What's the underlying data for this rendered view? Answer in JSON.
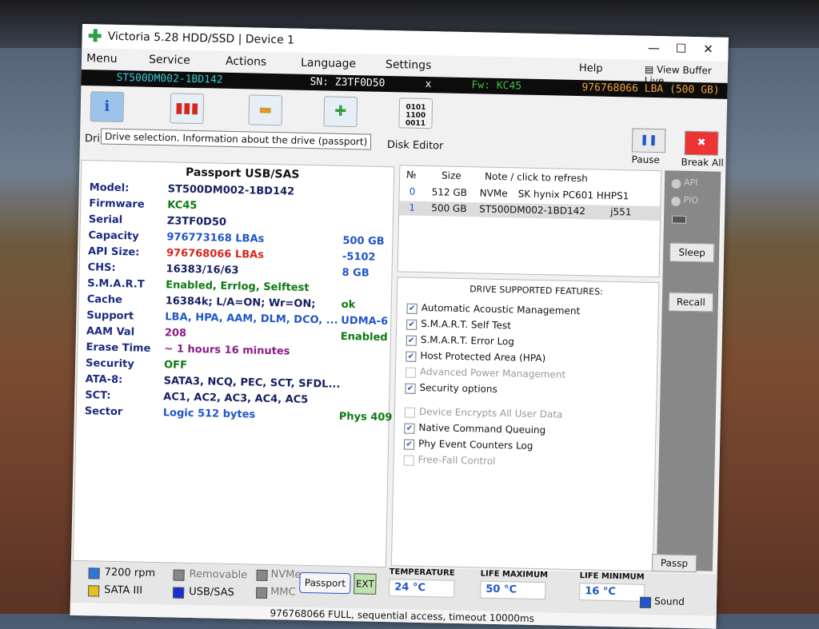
{
  "window": {
    "title": "Victoria 5.28 HDD/SSD | Device 1"
  },
  "window_controls": {
    "minimize": "—",
    "maximize": "☐",
    "close": "✕"
  },
  "menu": {
    "menu_label": "Menu",
    "service_label": "Service",
    "actions_label": "Actions",
    "language_label": "Language",
    "settings_label": "Settings",
    "help_label": "Help",
    "view_buffer_label": "View Buffer Live"
  },
  "drive_bar": {
    "model": "ST500DM002-1BD142",
    "serial": "SN: Z3TF0D50",
    "close_mark": "x",
    "firmware": "Fw: KC45",
    "lba": "976768066 LBA (500 GB)"
  },
  "toolbar": {
    "drive_label": "Driv",
    "disk_editor_label": "Disk Editor",
    "pause_label": "Pause",
    "break_all_label": "Break All",
    "tooltip": "Drive selection. Information about the drive (passport)",
    "tooltip_tail": "r"
  },
  "passport": {
    "title": "Passport USB/SAS",
    "rows": [
      {
        "key": "Model:",
        "value": "ST500DM002-1BD142",
        "extra": ""
      },
      {
        "key": "Firmware",
        "value": "KC45",
        "extra": ""
      },
      {
        "key": "Serial",
        "value": "Z3TF0D50",
        "extra": ""
      },
      {
        "key": "Capacity",
        "value": "976773168 LBAs",
        "extra": "500 GB"
      },
      {
        "key": "API Size:",
        "value": "976768066 LBAs",
        "extra": "-5102"
      },
      {
        "key": "CHS:",
        "value": "16383/16/63",
        "extra": "8 GB"
      },
      {
        "key": "S.M.A.R.T",
        "value": "Enabled, Errlog, Selftest",
        "extra": ""
      },
      {
        "key": "Cache",
        "value": "16384k; L/A=ON; Wr=ON;",
        "extra": "ok"
      },
      {
        "key": "Support",
        "value": "LBA, HPA, AAM, DLM, DCO, ...",
        "extra": "UDMA-6"
      },
      {
        "key": "AAM Val",
        "value": "208",
        "extra": "Enabled"
      },
      {
        "key": "Erase Time",
        "value": "~ 1 hours 16 minutes",
        "extra": ""
      },
      {
        "key": "Security",
        "value": "OFF",
        "extra": ""
      },
      {
        "key": "ATA-8:",
        "value": "SATA3, NCQ, PEC, SCT, SFDL...",
        "extra": ""
      },
      {
        "key": "SCT:",
        "value": "AC1, AC2, AC3, AC4, AC5",
        "extra": ""
      },
      {
        "key": "Sector",
        "value": "Logic 512 bytes",
        "extra": "Phys 409"
      }
    ]
  },
  "drive_list": {
    "columns": {
      "no": "№",
      "size": "Size",
      "note": "Note / click to refresh"
    },
    "rows": [
      {
        "no": "0",
        "size": "512 GB",
        "iface": "NVMe",
        "note": "SK hynix PC601 HHPS1",
        "tail": ""
      },
      {
        "no": "1",
        "size": "500 GB",
        "iface": "ST500DM002-1BD142",
        "note": "",
        "tail": "j551"
      }
    ]
  },
  "features": {
    "title": "DRIVE SUPPORTED FEATURES:",
    "items": [
      {
        "label": "Automatic Acoustic Management",
        "checked": "✔"
      },
      {
        "label": "S.M.A.R.T. Self Test",
        "checked": "✔"
      },
      {
        "label": "S.M.A.R.T. Error Log",
        "checked": "✔"
      },
      {
        "label": "Host Protected Area (HPA)",
        "checked": "✔"
      },
      {
        "label": "Advanced Power Management",
        "checked": ""
      },
      {
        "label": "Security options",
        "checked": "✔"
      },
      {
        "label": "Device Encrypts All User Data",
        "checked": ""
      },
      {
        "label": "Native Command Queuing",
        "checked": "✔"
      },
      {
        "label": "Phy Event Counters Log",
        "checked": "✔"
      },
      {
        "label": "Free-Fall Control",
        "checked": ""
      }
    ]
  },
  "right_panel": {
    "api_label": "API",
    "pio_label": "PIO",
    "sleep_label": "Sleep",
    "recall_label": "Recall",
    "passp_label": "Passp",
    "sound_label": "Sound"
  },
  "bottom": {
    "rpm": "7200 rpm",
    "sata": "SATA III",
    "removable": "Removable",
    "usb_sas": "USB/SAS",
    "nvme": "NVMe",
    "mmc": "MMC",
    "passport_btn": "Passport",
    "ext_btn": "EXT",
    "temperature_label": "TEMPERATURE",
    "temperature_value": "24 °C",
    "life_max_label": "LIFE MAXIMUM",
    "life_max_value": "50 °C",
    "life_min_label": "LIFE MINIMUM",
    "life_min_value": "16 °C"
  },
  "status": {
    "text": "976768066 FULL, sequential access, timeout 10000ms"
  },
  "colors": {
    "accent_blue": "#1f56c8",
    "green_text": "#0b7a12",
    "red_text": "#d7261c",
    "purple_text": "#8a1b85",
    "drive_bar_bg": "#0c0c0c",
    "model_cyan": "#36c8d8",
    "firmware_green": "#3fbf3f",
    "lba_orange": "#f0a040"
  }
}
